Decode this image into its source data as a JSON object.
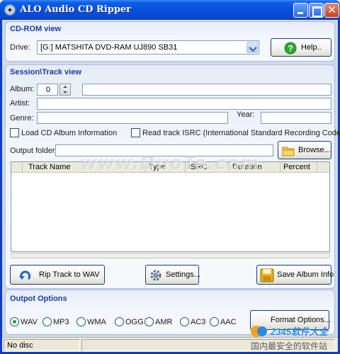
{
  "window": {
    "title": "ALO Audio CD Ripper"
  },
  "cdrom": {
    "header": "CD-ROM view",
    "drive_label": "Drive:",
    "drive_value": "[G:]  MATSHITA  DVD-RAM UJ890     SB31",
    "help_label": "Help.."
  },
  "session": {
    "header": "Session\\Track view",
    "album_label": "Album:",
    "album_number": "0",
    "artist_label": "Artist:",
    "genre_label": "Genre:",
    "year_label": "Year:",
    "load_cd_info_label": "Load CD Album Information",
    "read_isrc_label": "Read track ISRC (International Standard Recording Code)",
    "output_folder_label": "Output folder:",
    "browse_label": "Browse...",
    "columns": [
      "Track Name",
      "Type",
      "ISRC",
      "Duration",
      "Percent"
    ],
    "rip_label": "Rip Track to WAV",
    "settings_label": "Settings...",
    "save_album_label": "Save Album Info"
  },
  "output": {
    "header": "Outpot Options",
    "formats": [
      "WAV",
      "MP3",
      "WMA",
      "OGG",
      "AMR",
      "AC3",
      "AAC"
    ],
    "selected": "WAV",
    "format_options_label": "Format Options..."
  },
  "status": {
    "text": "No disc"
  },
  "watermarks": {
    "center": "www.DuoTe.com",
    "brand_logo": "2345软件大全",
    "brand_sub": "国内最安全的软件站"
  },
  "colors": {
    "titlebar": "#0a4fdc",
    "panel_header": "#1a3aa8",
    "help_green": "#2fa82f",
    "radio_green": "#21a121"
  }
}
